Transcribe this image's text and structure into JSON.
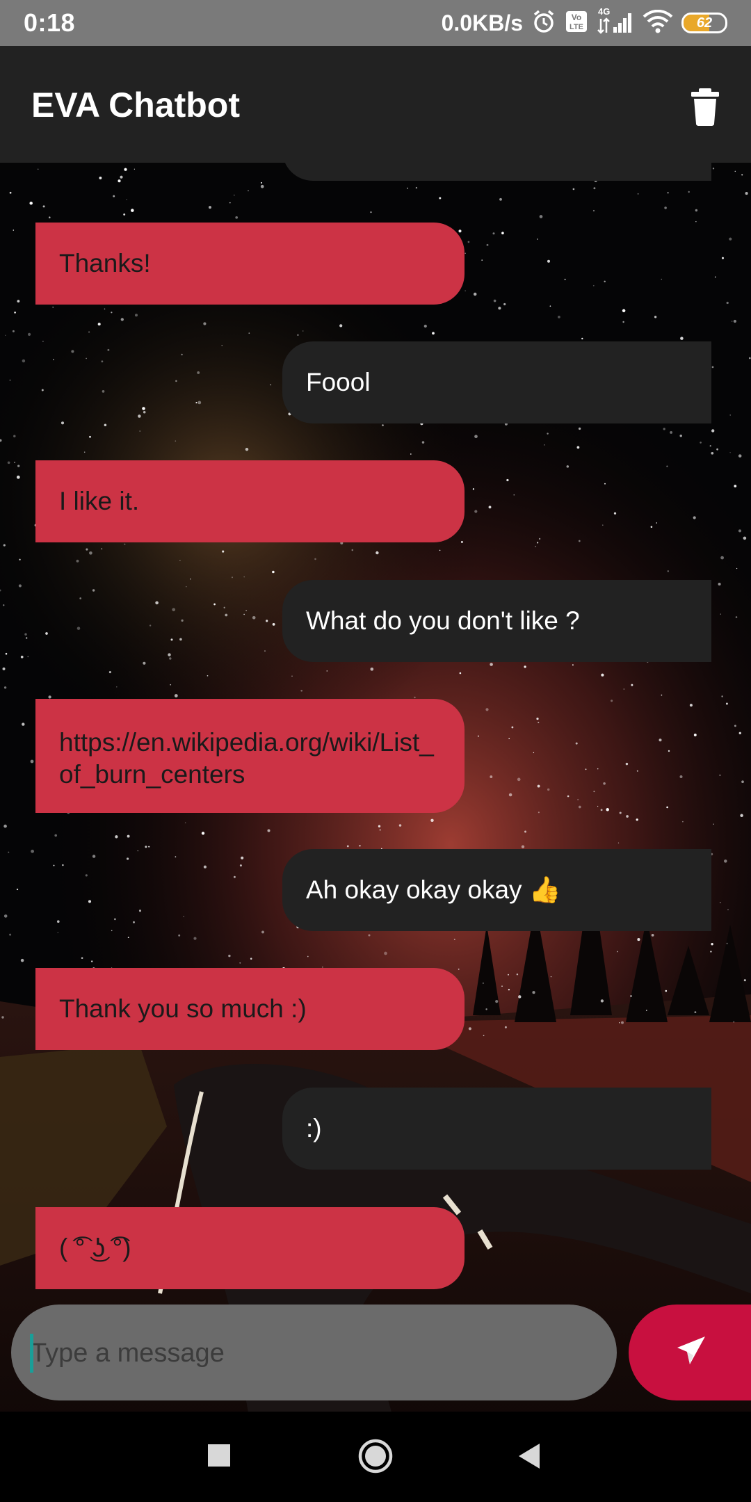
{
  "status_bar": {
    "time": "0:18",
    "network_speed": "0.0KB/s",
    "volte_label": "Vo LTE",
    "network_type": "4G",
    "battery_level": "62",
    "icons": [
      "alarm-icon",
      "volte-icon",
      "signal-icon",
      "wifi-icon",
      "battery-icon"
    ]
  },
  "app_bar": {
    "title": "EVA Chatbot",
    "action_icon": "delete-icon"
  },
  "messages": [
    {
      "sender": "user",
      "text": "Thanks!"
    },
    {
      "sender": "bot",
      "text": "Foool"
    },
    {
      "sender": "user",
      "text": "I like it."
    },
    {
      "sender": "bot",
      "text": "What do you don't like ?"
    },
    {
      "sender": "user",
      "text": "https://en.wikipedia.org/wiki/List_of_burn_centers"
    },
    {
      "sender": "bot",
      "text": "Ah okay okay okay 👍"
    },
    {
      "sender": "user",
      "text": "Thank you so much :)"
    },
    {
      "sender": "bot",
      "text": ":)"
    },
    {
      "sender": "user",
      "text": "( ͡° ͜ʖ ͡°)"
    }
  ],
  "composer": {
    "placeholder": "Type a message",
    "value": "",
    "send_icon": "send-icon"
  },
  "nav_bar": {
    "icons": [
      "recents-icon",
      "home-icon",
      "back-icon"
    ]
  },
  "colors": {
    "user_bubble": "#cc3345",
    "bot_bubble": "#222222",
    "app_bar": "#222222",
    "send_button": "#c8103f",
    "input_background": "#6b6b6b",
    "cursor": "#1a9e98"
  }
}
